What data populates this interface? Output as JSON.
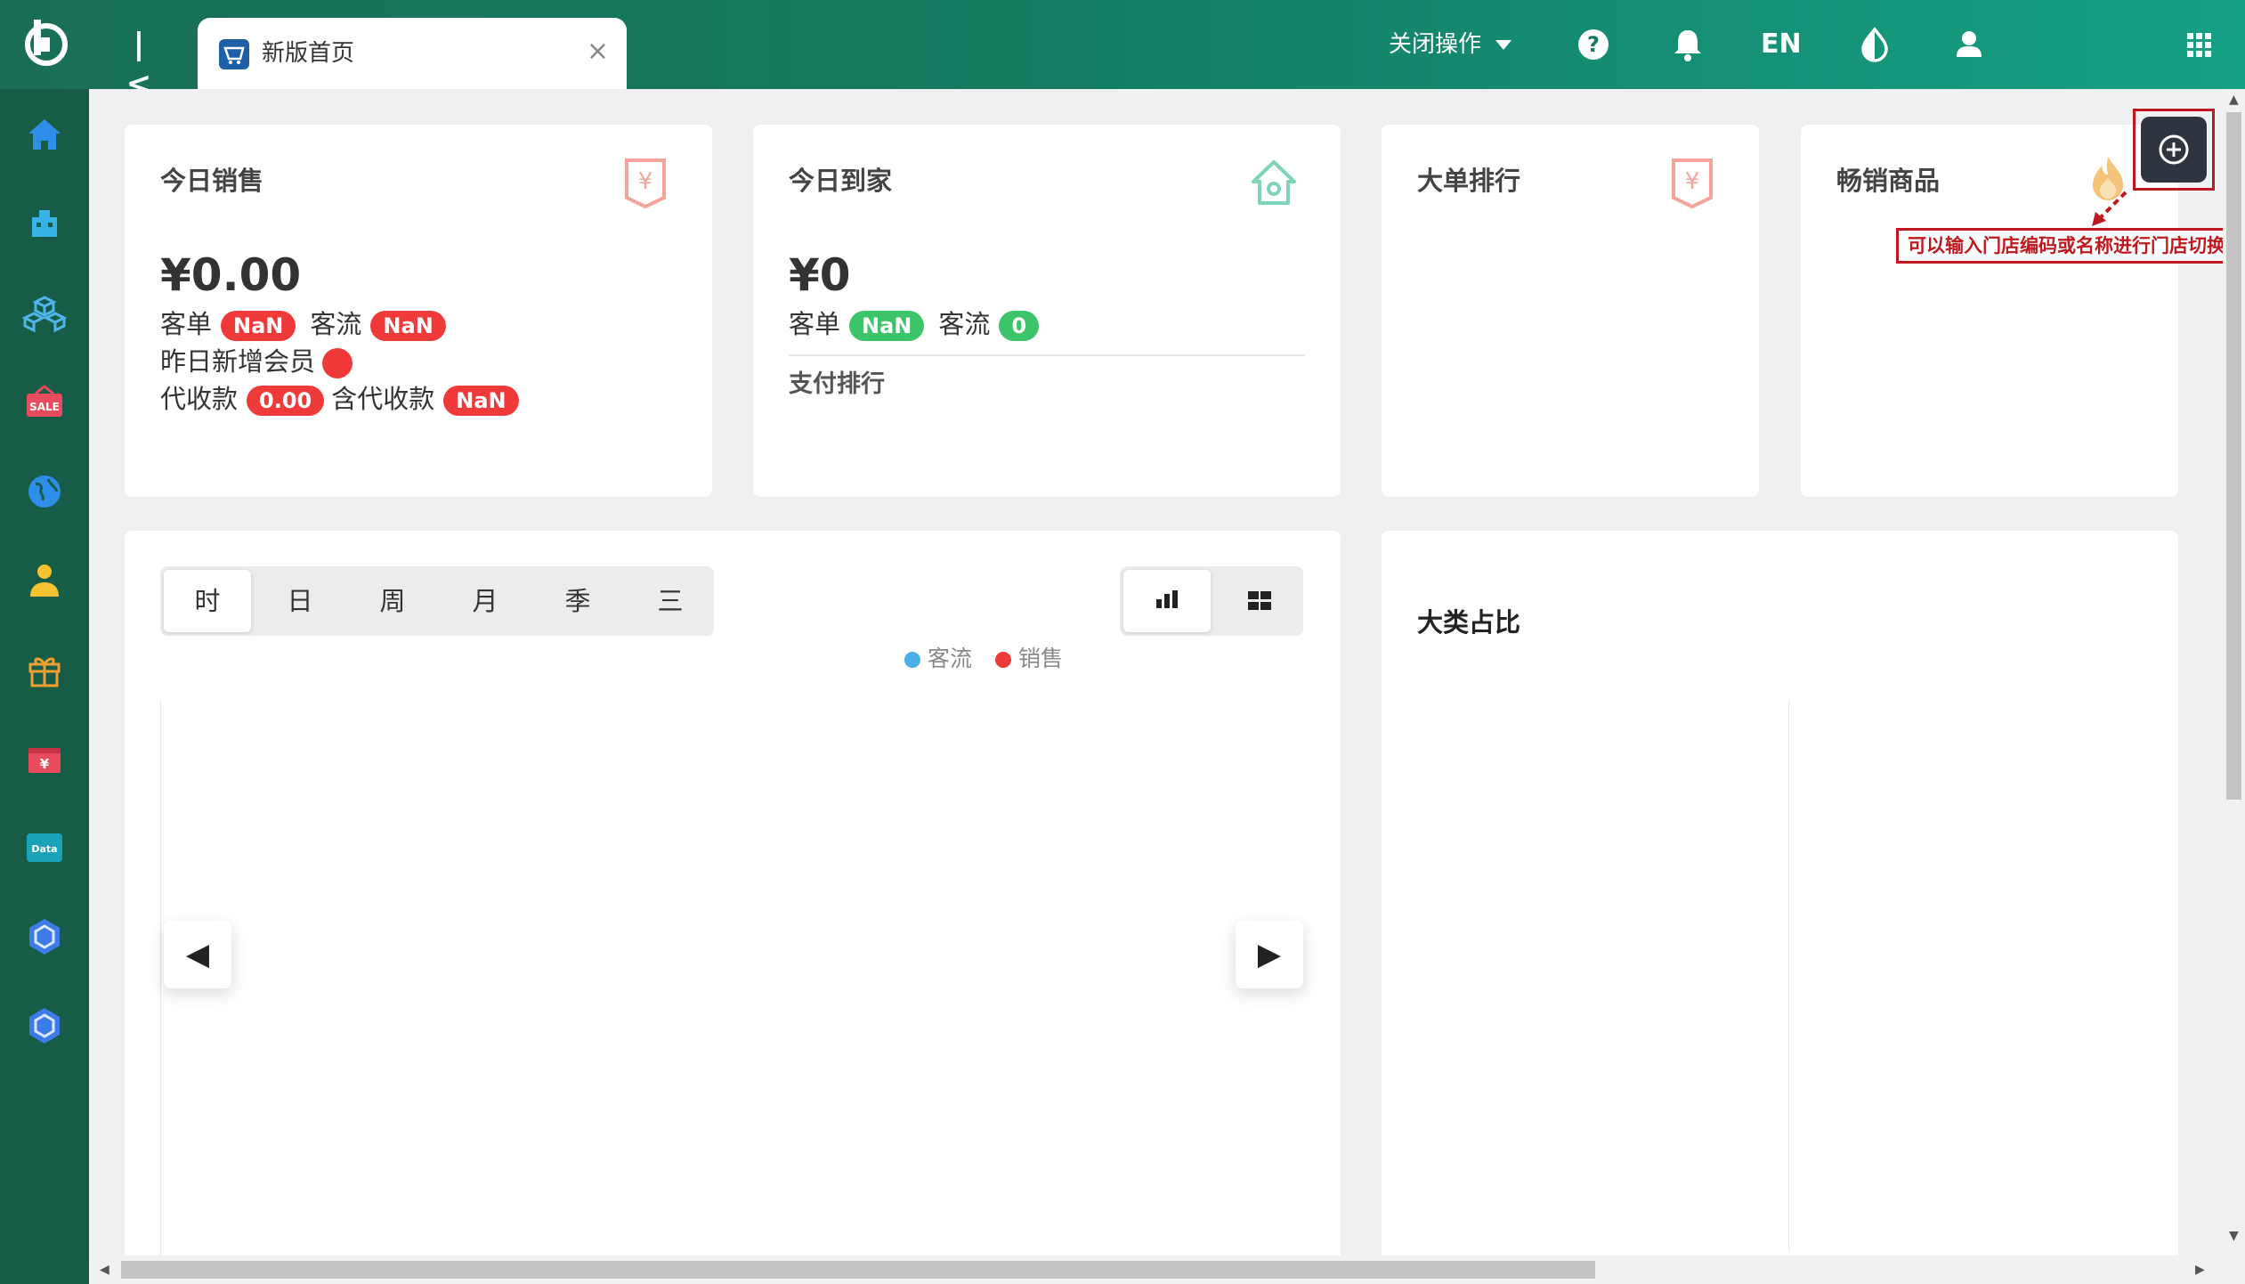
{
  "app": {
    "tab_label": "新版首页",
    "tab_close": "×",
    "collapse_symbol": "|<",
    "close_ops_label": "关闭操作",
    "lang_label": "EN"
  },
  "icons": {
    "logo": "logo-icon",
    "help": "help-icon",
    "bell": "bell-icon",
    "theme": "theme-icon",
    "user": "user-icon",
    "apps": "apps-grid-icon"
  },
  "colors": {
    "topbar_start": "#1a6e57",
    "topbar_end": "#16a085",
    "sidebar": "#175c46",
    "badge_red": "#f03a3a",
    "badge_green": "#3cc46a",
    "annotation_red": "#c0181f"
  },
  "sidebar": {
    "items": [
      {
        "icon": "home-icon"
      },
      {
        "icon": "store-icon"
      },
      {
        "icon": "cubes-icon"
      },
      {
        "icon": "sale-tag-icon",
        "text": "SALE"
      },
      {
        "icon": "globe-icon"
      },
      {
        "icon": "member-icon"
      },
      {
        "icon": "gift-icon"
      },
      {
        "icon": "cashier-icon",
        "text": "¥"
      },
      {
        "icon": "data-icon",
        "text": "Data"
      },
      {
        "icon": "hexagon-icon"
      },
      {
        "icon": "hexagon-icon"
      }
    ]
  },
  "cards": {
    "today_sales": {
      "title": "今日销售",
      "value": "¥0.00",
      "order_label": "客单",
      "order_value": "NaN",
      "traffic_label": "客流",
      "traffic_value": "NaN",
      "new_member_label": "昨日新增会员",
      "collect_label": "代收款",
      "collect_value": "0.00",
      "incl_collect_label": "含代收款",
      "incl_collect_value": "NaN"
    },
    "today_home": {
      "title": "今日到家",
      "value": "¥0",
      "order_label": "客单",
      "order_value": "NaN",
      "traffic_label": "客流",
      "traffic_value": "0",
      "pay_rank_label": "支付排行"
    },
    "big_order": {
      "title": "大单排行"
    },
    "best_seller": {
      "title": "畅销商品"
    },
    "category_share": {
      "title": "大类占比"
    }
  },
  "period_tabs": [
    "时",
    "日",
    "周",
    "月",
    "季",
    "三"
  ],
  "active_period": "时",
  "legend": [
    {
      "label": "客流",
      "color": "#4aaee8"
    },
    {
      "label": "销售",
      "color": "#f03a3a"
    }
  ],
  "nav": {
    "prev": "◀",
    "next": "▶"
  },
  "tooltip": "可以输入门店编码或名称进行门店切换"
}
